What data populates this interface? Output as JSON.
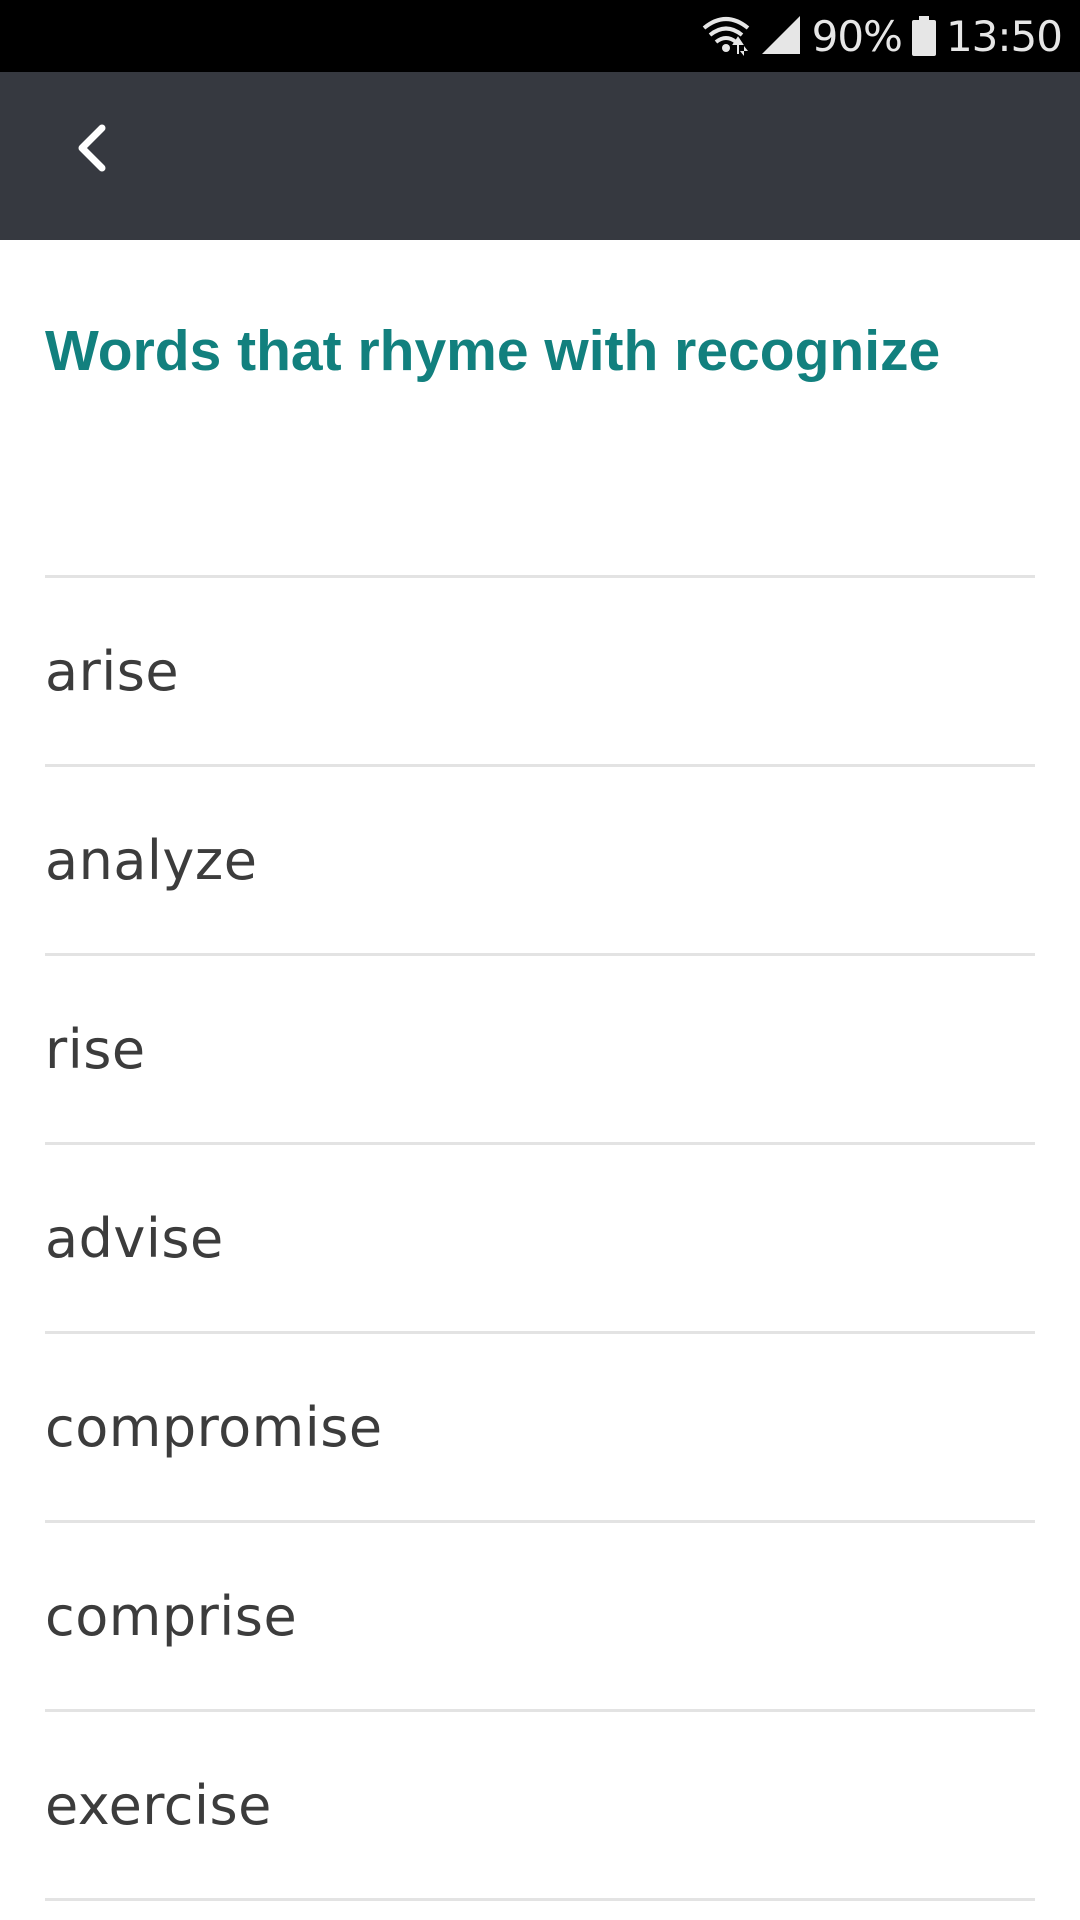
{
  "status_bar": {
    "battery": "90%",
    "time": "13:50",
    "icons": [
      "wifi-icon",
      "signal-icon",
      "battery-icon"
    ]
  },
  "app_bar": {
    "back_icon": "chevron-left-icon"
  },
  "page": {
    "title": "Words that rhyme with recognize"
  },
  "rhymes": [
    {
      "word": "arise"
    },
    {
      "word": "analyze"
    },
    {
      "word": "rise"
    },
    {
      "word": "advise"
    },
    {
      "word": "compromise"
    },
    {
      "word": "comprise"
    },
    {
      "word": "exercise"
    }
  ],
  "colors": {
    "accent": "#12807e",
    "app_bar": "#363940",
    "status_bar": "#000000",
    "divider": "#e3e3e3",
    "word_text": "#3c3c3c"
  }
}
